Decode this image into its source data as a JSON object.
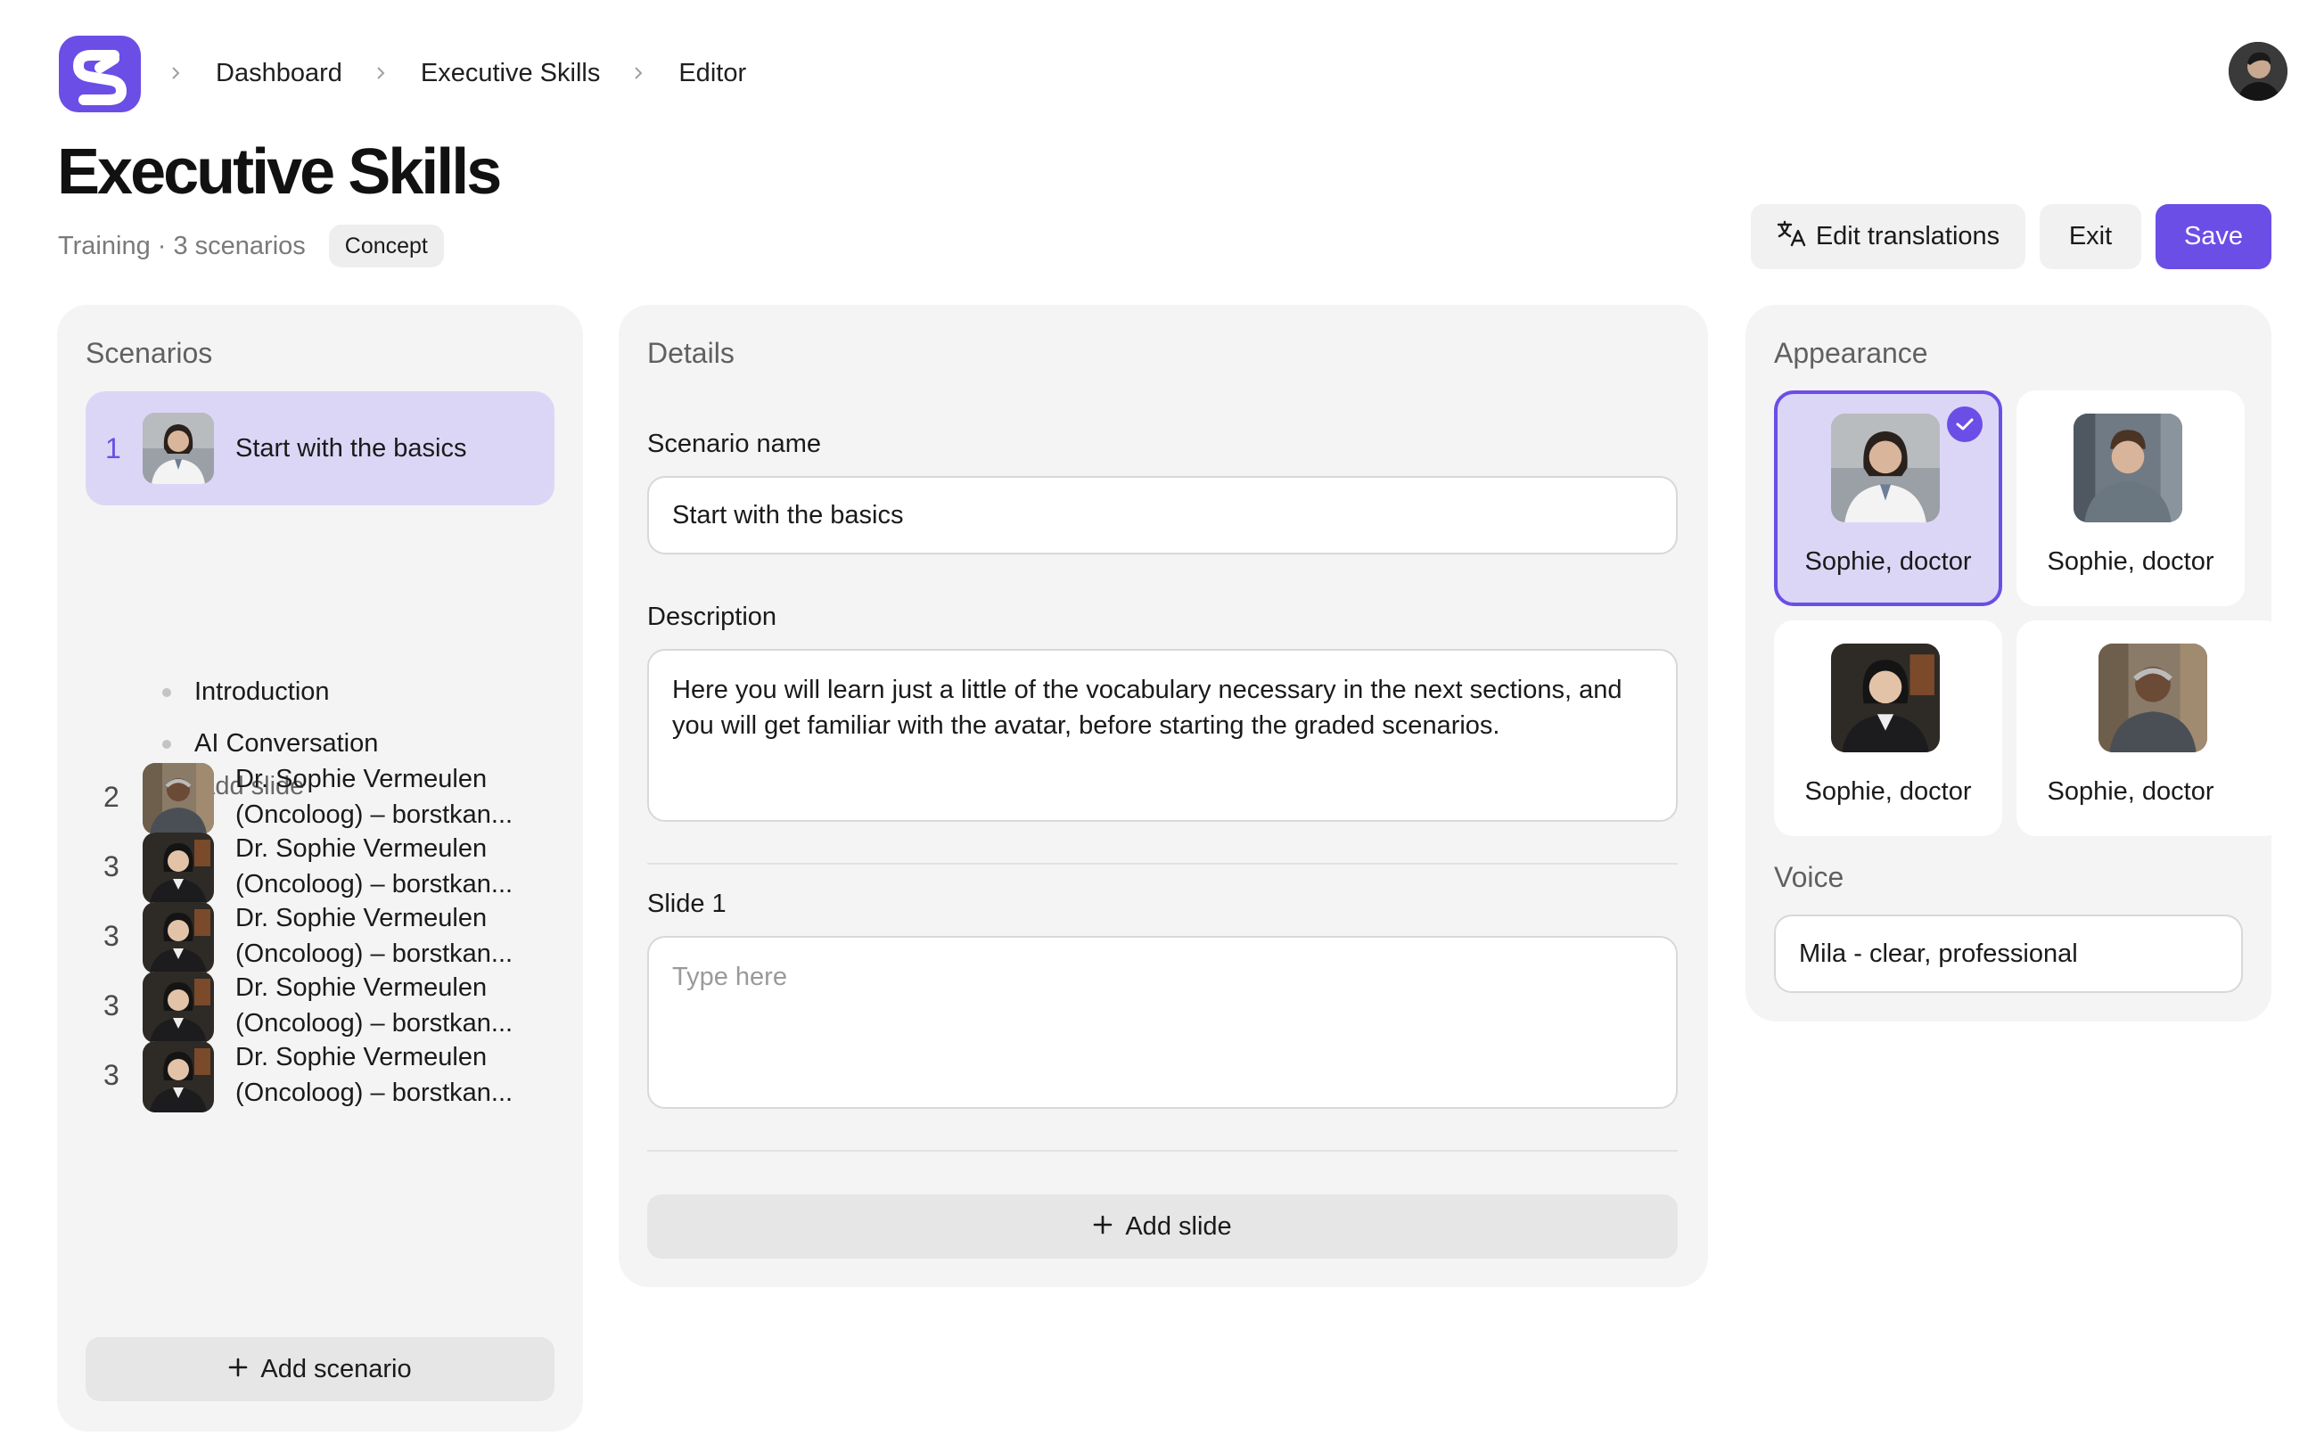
{
  "colors": {
    "accent": "#6b4ee6",
    "accent_soft": "#dcd6f6",
    "panel_bg": "#f4f4f4"
  },
  "breadcrumbs": [
    "Dashboard",
    "Executive Skills",
    "Editor"
  ],
  "page": {
    "title": "Executive Skills",
    "meta": "Training · 3 scenarios",
    "badge": "Concept"
  },
  "actions": {
    "edit_translations": "Edit translations",
    "exit": "Exit",
    "save": "Save"
  },
  "scenarios": {
    "title": "Scenarios",
    "active": {
      "number": "1",
      "label": "Start with the basics",
      "slides": [
        "Introduction",
        "AI Conversation"
      ],
      "add_slide": "Add slide"
    },
    "items": [
      {
        "number": "2",
        "line1": "Dr. Sophie Vermeulen",
        "line2": "(Oncoloog) – borstkan..."
      },
      {
        "number": "3",
        "line1": "Dr. Sophie Vermeulen",
        "line2": "(Oncoloog) – borstkan..."
      },
      {
        "number": "3",
        "line1": "Dr. Sophie Vermeulen",
        "line2": "(Oncoloog) – borstkan..."
      },
      {
        "number": "3",
        "line1": "Dr. Sophie Vermeulen",
        "line2": "(Oncoloog) – borstkan..."
      },
      {
        "number": "3",
        "line1": "Dr. Sophie Vermeulen",
        "line2": "(Oncoloog) – borstkan..."
      }
    ],
    "add_scenario": "Add scenario"
  },
  "details": {
    "title": "Details",
    "scenario_name_label": "Scenario name",
    "scenario_name_value": "Start with the basics",
    "description_label": "Description",
    "description_value": "Here you will learn just a little of the vocabulary necessary in the next sections, and you will get familiar with the avatar, before starting the graded scenarios.",
    "slide_label": "Slide 1",
    "slide_placeholder": "Type here",
    "add_slide": "Add slide"
  },
  "appearance": {
    "title": "Appearance",
    "avatars": [
      {
        "label": "Sophie, doctor",
        "selected": true,
        "icon": "check-icon"
      },
      {
        "label": "Sophie, doctor",
        "selected": false
      },
      {
        "label": "Sophie, doctor",
        "selected": false
      },
      {
        "label": "Sophie, doctor",
        "selected": false
      }
    ],
    "voice_label": "Voice",
    "voice_value": "Mila - clear, professional"
  }
}
